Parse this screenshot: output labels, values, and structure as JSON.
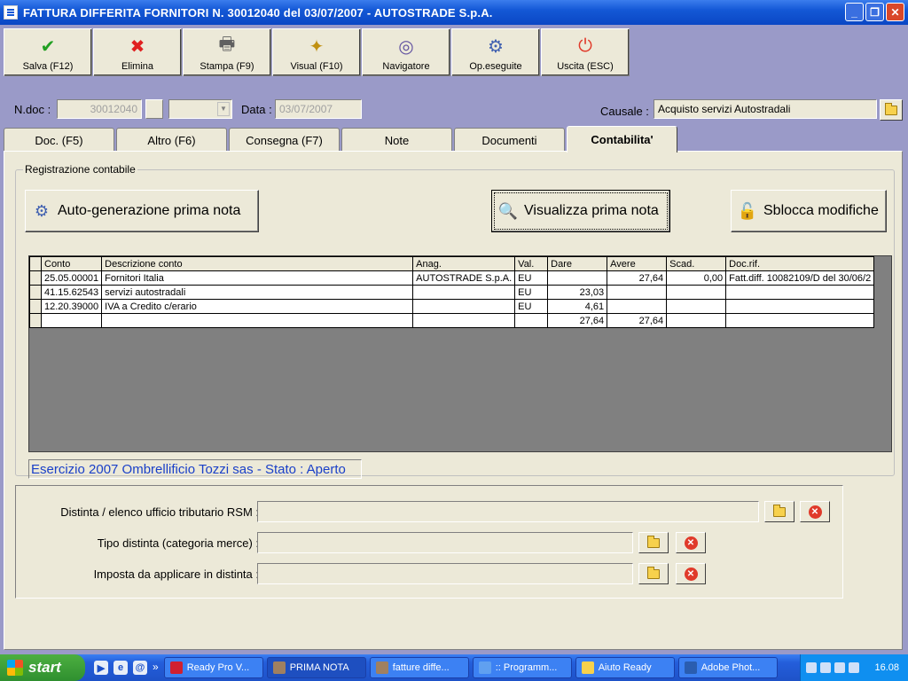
{
  "window": {
    "title": "FATTURA DIFFERITA FORNITORI N. 30012040  del 03/07/2007 - AUTOSTRADE S.p.A.",
    "min": "_",
    "max": "❐",
    "close": "✕"
  },
  "toolbar": [
    {
      "label": "Salva (F12)",
      "icon": "✔",
      "color": "#22a022"
    },
    {
      "label": "Elimina",
      "icon": "✖",
      "color": "#e02020"
    },
    {
      "label": "Stampa (F9)",
      "icon": "🖶",
      "color": "#606060"
    },
    {
      "label": "Visual (F10)",
      "icon": "✦",
      "color": "#c09010"
    },
    {
      "label": "Navigatore",
      "icon": "◎",
      "color": "#6050a0"
    },
    {
      "label": "Op.eseguite",
      "icon": "⚙",
      "color": "#4060b0"
    },
    {
      "label": "Uscita (ESC)",
      "icon": "⏻",
      "color": "#e03a2a"
    }
  ],
  "header": {
    "ndoc_label": "N.doc :",
    "ndoc_value": "30012040",
    "data_label": "Data :",
    "data_value": "03/07/2007",
    "causale_label": "Causale :",
    "causale_value": "Acquisto servizi Autostradali"
  },
  "tabs": [
    "Doc. (F5)",
    "Altro (F6)",
    "Consegna (F7)",
    "Note",
    "Documenti",
    "Contabilita'"
  ],
  "group": {
    "legend": "Registrazione contabile",
    "btn_auto": "Auto-generazione prima nota",
    "btn_visual": "Visualizza prima nota",
    "btn_sblocca": "Sblocca modifiche"
  },
  "grid": {
    "columns": [
      "Conto",
      "Descrizione conto",
      "Anag.",
      "Val.",
      "Dare",
      "Avere",
      "Scad.",
      "Doc.rif."
    ],
    "rows": [
      [
        "25.05.00001",
        "Fornitori Italia",
        "AUTOSTRADE S.p.A.",
        "EU",
        "",
        "27,64",
        "0,00",
        "Fatt.diff. 10082109/D del 30/06/2"
      ],
      [
        "41.15.62543",
        "servizi autostradali",
        "",
        "EU",
        "23,03",
        "",
        "",
        ""
      ],
      [
        "12.20.39000",
        "IVA a Credito c/erario",
        "",
        "EU",
        "4,61",
        "",
        "",
        ""
      ],
      [
        "",
        "",
        "",
        "",
        "27,64",
        "27,64",
        "",
        ""
      ]
    ]
  },
  "status": "Esercizio 2007 Ombrellificio Tozzi sas - Stato : Aperto",
  "lower": {
    "distinta_label": "Distinta / elenco ufficio tributario RSM :",
    "tipo_label": "Tipo distinta (categoria merce) :",
    "imposta_label": "Imposta da applicare in distinta :"
  },
  "taskbar": {
    "start": "start",
    "more": "»",
    "tasks": [
      "Ready Pro V...",
      "PRIMA NOTA",
      "fatture diffe...",
      ":: Programm...",
      "Aiuto Ready",
      "Adobe Phot..."
    ],
    "clock": "16.08"
  }
}
